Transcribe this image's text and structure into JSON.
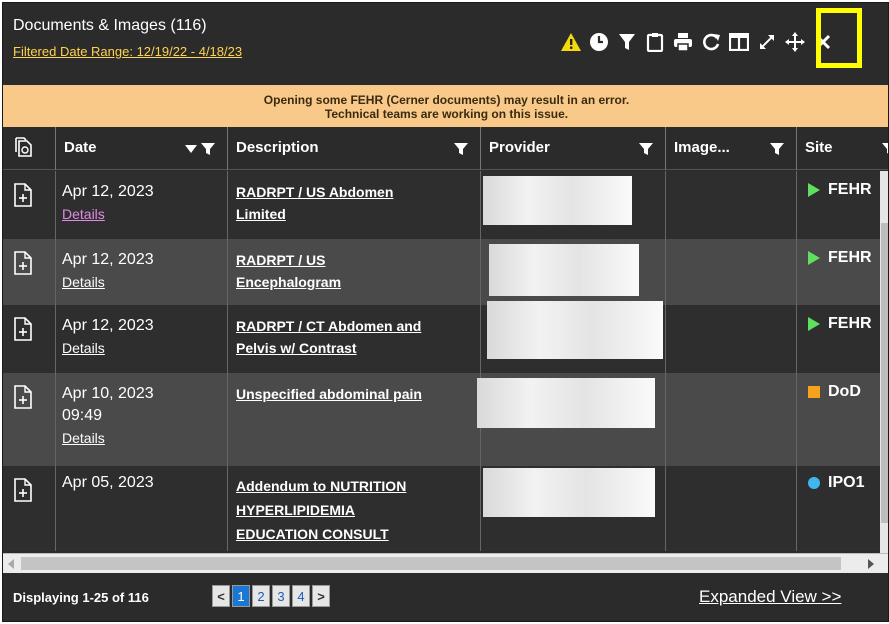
{
  "header": {
    "title": "Documents & Images (116)",
    "date_range": "Filtered Date Range: 12/19/22 - 4/18/23"
  },
  "toolbar": {
    "icons": [
      "warning-icon",
      "clock-icon",
      "filter-icon",
      "clipboard-icon",
      "print-icon",
      "refresh-icon",
      "columns-icon",
      "expand-icon",
      "move-icon",
      "close-icon"
    ],
    "warning_color": "#f5d90a",
    "highlight_color": "#ffff00"
  },
  "banner": {
    "line1": "Opening some FEHR (Cerner documents) may result in an error.",
    "line2": "Technical teams are working on this issue."
  },
  "columns": {
    "date": "Date",
    "description": "Description",
    "provider": "Provider",
    "image": "Image...",
    "site": "Site"
  },
  "rows": [
    {
      "date": "Apr 12, 2023",
      "time": "",
      "details": "Details",
      "desc1": "RADRPT / US Abdomen",
      "desc2": "Limited",
      "desc3": "",
      "site": "FEHR",
      "site_marker": "green-triangle"
    },
    {
      "date": "Apr 12, 2023",
      "time": "",
      "details": "Details",
      "desc1": "RADRPT / US",
      "desc2": "Encephalogram",
      "desc3": "",
      "site": "FEHR",
      "site_marker": "green-triangle"
    },
    {
      "date": "Apr 12, 2023",
      "time": "",
      "details": "Details",
      "desc1": "RADRPT / CT Abdomen and",
      "desc2": "Pelvis w/ Contrast",
      "desc3": "",
      "site": "FEHR",
      "site_marker": "green-triangle"
    },
    {
      "date": "Apr 10, 2023",
      "time": "09:49",
      "details": "Details",
      "desc1": "Unspecified abdominal pain",
      "desc2": "",
      "desc3": "",
      "site": "DoD",
      "site_marker": "orange-square"
    },
    {
      "date": "Apr 05, 2023",
      "time": "",
      "details": "",
      "desc1": "Addendum to NUTRITION",
      "desc2": "HYPERLIPIDEMIA",
      "desc3": "EDUCATION CONSULT",
      "site": "IPO1",
      "site_marker": "blue-circle"
    }
  ],
  "footer": {
    "displaying": "Displaying 1-25 of 116",
    "pages": [
      "1",
      "2",
      "3",
      "4"
    ],
    "prev": "<",
    "next": ">",
    "expanded_view": "Expanded View >>"
  },
  "colors": {
    "banner_bg": "#f9c98a",
    "link_yellow": "#ffd34e",
    "visited_link": "#e08ae6",
    "active_page": "#1a78d4"
  }
}
